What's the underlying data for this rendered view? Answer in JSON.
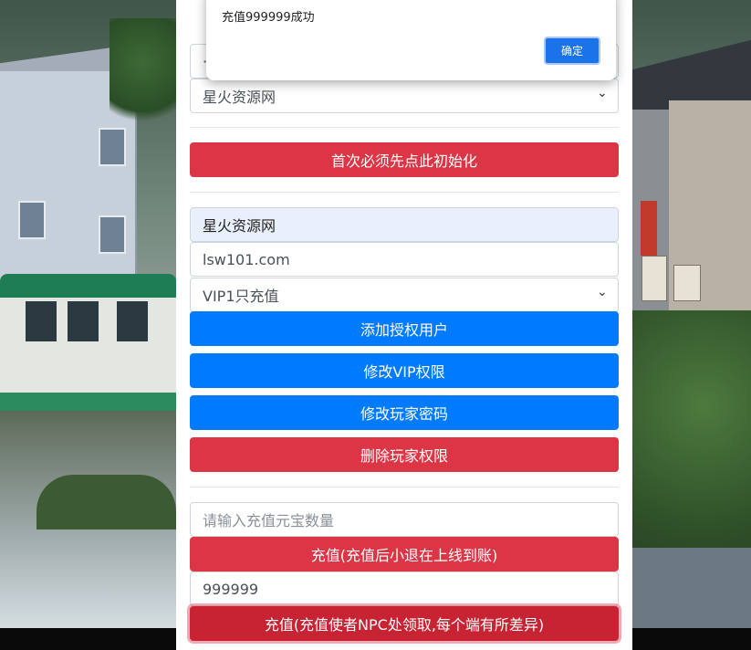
{
  "dialog": {
    "message": "充值999999成功",
    "ok_label": "确定"
  },
  "form": {
    "partial_field_value": "·",
    "server_select_value": "星火资源网",
    "init_button_label": "首次必须先点此初始化",
    "site_name_value": "星火资源网",
    "account_value": "lsw101.com",
    "vip_select_value": "VIP1只充值",
    "add_user_label": "添加授权用户",
    "modify_vip_label": "修改VIP权限",
    "modify_password_label": "修改玩家密码",
    "delete_player_label": "删除玩家权限",
    "ingot_placeholder": "请输入充值元宝数量",
    "recharge_ingot_label": "充值(充值后小退在上线到账)",
    "amount_value": "999999",
    "recharge_npc_label": "充值(充值使者NPC处领取,每个端有所差异)"
  },
  "colors": {
    "primary_blue": "#007bff",
    "danger_red": "#dc3545",
    "dialog_button": "#1a73e8"
  }
}
